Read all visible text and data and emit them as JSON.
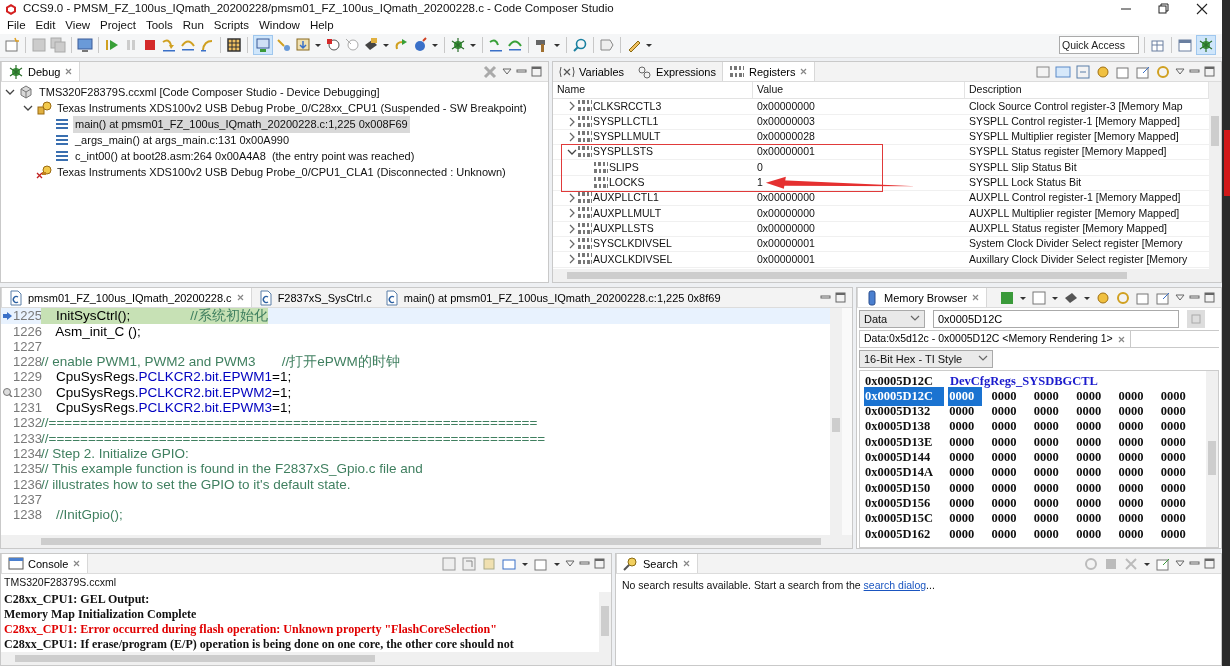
{
  "window": {
    "title": "CCS9.0 - PMSM_FZ_100us_IQmath_20200228/pmsm01_FZ_100us_IQmath_20200228.c - Code Composer Studio"
  },
  "menu": [
    "File",
    "Edit",
    "View",
    "Project",
    "Tools",
    "Run",
    "Scripts",
    "Window",
    "Help"
  ],
  "toolbar": {
    "quick_access": {
      "placeholder": "Quick Access"
    }
  },
  "debug_view": {
    "tab": {
      "label": "Debug",
      "selected": true
    },
    "tree": [
      {
        "label": "TMS320F28379S.ccxml [Code Composer Studio - Device Debugging]",
        "kind": "target",
        "expanded": true,
        "selected": false,
        "children": [
          {
            "label": "Texas Instruments XDS100v2 USB Debug Probe_0/C28xx_CPU1 (Suspended - SW Breakpoint)",
            "kind": "core",
            "expanded": true,
            "selected": false,
            "children": [
              {
                "label": "main() at pmsm01_FZ_100us_IQmath_20200228.c:1,225 0x008F69",
                "kind": "frame",
                "selected": true
              },
              {
                "label": "_args_main() at args_main.c:131 0x00A990",
                "kind": "frame",
                "selected": false
              },
              {
                "label": "c_int00() at boot28.asm:264 0x00A4A8  (the entry point was reached)",
                "kind": "frame",
                "selected": false
              }
            ]
          },
          {
            "label": "Texas Instruments XDS100v2 USB Debug Probe_0/CPU1_CLA1 (Disconnected : Unknown)",
            "kind": "core_disconnected",
            "selected": false
          }
        ]
      }
    ]
  },
  "registers_view": {
    "tabs": [
      {
        "label": "Variables",
        "kind": "variables",
        "selected": false
      },
      {
        "label": "Expressions",
        "kind": "expressions",
        "selected": false
      },
      {
        "label": "Registers",
        "kind": "registers",
        "selected": true
      }
    ],
    "columns": [
      "Name",
      "Value",
      "Description"
    ],
    "rows": [
      {
        "name": "CLKSRCCTL3",
        "value": "0x00000000",
        "description": "Clock Source Control register-3 [Memory Map",
        "expanded": false
      },
      {
        "name": "SYSPLLCTL1",
        "value": "0x00000003",
        "description": "SYSPLL Control register-1 [Memory Mapped]",
        "expanded": false
      },
      {
        "name": "SYSPLLMULT",
        "value": "0x00000028",
        "description": "SYSPLL Multiplier register [Memory Mapped]",
        "expanded": false
      },
      {
        "name": "SYSPLLSTS",
        "value": "0x00000001",
        "description": "SYSPLL Status register [Memory Mapped]",
        "expanded": true,
        "highlighted": true,
        "children": [
          {
            "name": "SLIPS",
            "value": "0",
            "description": "SYSPLL Slip Status Bit"
          },
          {
            "name": "LOCKS",
            "value": "1",
            "description": "SYSPLL Lock Status Bit",
            "arrow": true
          }
        ]
      },
      {
        "name": "AUXPLLCTL1",
        "value": "0x00000000",
        "description": "AUXPLL Control register-1 [Memory Mapped]",
        "expanded": false
      },
      {
        "name": "AUXPLLMULT",
        "value": "0x00000000",
        "description": "AUXPLL Multiplier register [Memory Mapped]",
        "expanded": false
      },
      {
        "name": "AUXPLLSTS",
        "value": "0x00000000",
        "description": "AUXPLL Status register [Memory Mapped]",
        "expanded": false
      },
      {
        "name": "SYSCLKDIVSEL",
        "value": "0x00000001",
        "description": "System Clock Divider Select register [Memory",
        "expanded": false
      },
      {
        "name": "AUXCLKDIVSEL",
        "value": "0x00000001",
        "description": "Auxillary Clock Divider Select register [Memory",
        "expanded": false
      }
    ]
  },
  "editor": {
    "tabs": [
      {
        "label": "pmsm01_FZ_100us_IQmath_20200228.c",
        "selected": true
      },
      {
        "label": "F2837xS_SysCtrl.c",
        "selected": false
      },
      {
        "label": "main() at pmsm01_FZ_100us_IQmath_20200228.c:1,225 0x8f69",
        "selected": false
      }
    ],
    "lines": [
      {
        "number": "1225",
        "current": true,
        "instruction_pointer": true,
        "segments": [
          {
            "kind": "code",
            "text": "    InitSysCtrl();"
          },
          {
            "kind": "comment",
            "text": "                //系统初始化"
          }
        ]
      },
      {
        "number": "1226",
        "segments": [
          {
            "kind": "code",
            "text": "    Asm_init_C ();"
          }
        ]
      },
      {
        "number": "1227"
      },
      {
        "number": "1228",
        "segments": [
          {
            "kind": "comment",
            "text": "// enable PWM1, PWM2 and PWM3       //打开ePWM的时钟"
          }
        ]
      },
      {
        "number": "1229",
        "segments": [
          {
            "kind": "code",
            "text": "    CpuSysRegs."
          },
          {
            "kind": "field",
            "text": "PCLKCR2.bit.EPWM1"
          },
          {
            "kind": "code",
            "text": "=1;"
          }
        ]
      },
      {
        "number": "1230",
        "bookmark": true,
        "segments": [
          {
            "kind": "code",
            "text": "    CpuSysRegs."
          },
          {
            "kind": "field",
            "text": "PCLKCR2.bit.EPWM2"
          },
          {
            "kind": "code",
            "text": "=1;"
          }
        ]
      },
      {
        "number": "1231",
        "segments": [
          {
            "kind": "code",
            "text": "    CpuSysRegs."
          },
          {
            "kind": "field",
            "text": "PCLKCR2.bit.EPWM3"
          },
          {
            "kind": "code",
            "text": "=1;"
          }
        ]
      },
      {
        "number": "1232",
        "segments": [
          {
            "kind": "comment",
            "text": "//=============================================================="
          }
        ]
      },
      {
        "number": "1233",
        "segments": [
          {
            "kind": "comment",
            "text": "//==============================================================="
          }
        ]
      },
      {
        "number": "1234",
        "segments": [
          {
            "kind": "comment",
            "text": "// Step 2. Initialize GPIO:"
          }
        ]
      },
      {
        "number": "1235",
        "segments": [
          {
            "kind": "comment",
            "text": "// This example function is found in the F2837xS_Gpio.c file and"
          }
        ]
      },
      {
        "number": "1236",
        "segments": [
          {
            "kind": "comment",
            "text": "// illustrates how to set the GPIO to it's default state."
          }
        ]
      },
      {
        "number": "1237"
      },
      {
        "number": "1238",
        "segments": [
          {
            "kind": "comment",
            "text": "    //InitGpio();"
          }
        ]
      }
    ]
  },
  "memory_browser": {
    "tab": {
      "label": "Memory Browser",
      "selected": true
    },
    "page": "Data",
    "address": "0x0005D12C",
    "rendering_tab": {
      "label": "Data:0x5d12c - 0x0005D12C <Memory Rendering 1>",
      "selected": true
    },
    "format": "16-Bit Hex - TI Style",
    "symbol": {
      "address": "0x0005D12C",
      "name": "DevCfgRegs_SYSDBGCTL"
    },
    "rows": [
      {
        "address": "0x0005D12C",
        "selected": true,
        "values": [
          {
            "text": "0000",
            "selected": true
          },
          {
            "text": "0000",
            "selected": false
          },
          {
            "text": "0000",
            "selected": false
          },
          {
            "text": "0000",
            "selected": false
          },
          {
            "text": "0000",
            "selected": false
          },
          {
            "text": "0000",
            "selected": false
          }
        ]
      },
      {
        "address": "0x0005D132",
        "selected": false,
        "values": [
          {
            "text": "0000",
            "selected": false
          },
          {
            "text": "0000",
            "selected": false
          },
          {
            "text": "0000",
            "selected": false
          },
          {
            "text": "0000",
            "selected": false
          },
          {
            "text": "0000",
            "selected": false
          },
          {
            "text": "0000",
            "selected": false
          }
        ]
      },
      {
        "address": "0x0005D138",
        "selected": false,
        "values": [
          {
            "text": "0000",
            "selected": false
          },
          {
            "text": "0000",
            "selected": false
          },
          {
            "text": "0000",
            "selected": false
          },
          {
            "text": "0000",
            "selected": false
          },
          {
            "text": "0000",
            "selected": false
          },
          {
            "text": "0000",
            "selected": false
          }
        ]
      },
      {
        "address": "0x0005D13E",
        "selected": false,
        "values": [
          {
            "text": "0000",
            "selected": false
          },
          {
            "text": "0000",
            "selected": false
          },
          {
            "text": "0000",
            "selected": false
          },
          {
            "text": "0000",
            "selected": false
          },
          {
            "text": "0000",
            "selected": false
          },
          {
            "text": "0000",
            "selected": false
          }
        ]
      },
      {
        "address": "0x0005D144",
        "selected": false,
        "values": [
          {
            "text": "0000",
            "selected": false
          },
          {
            "text": "0000",
            "selected": false
          },
          {
            "text": "0000",
            "selected": false
          },
          {
            "text": "0000",
            "selected": false
          },
          {
            "text": "0000",
            "selected": false
          },
          {
            "text": "0000",
            "selected": false
          }
        ]
      },
      {
        "address": "0x0005D14A",
        "selected": false,
        "values": [
          {
            "text": "0000",
            "selected": false
          },
          {
            "text": "0000",
            "selected": false
          },
          {
            "text": "0000",
            "selected": false
          },
          {
            "text": "0000",
            "selected": false
          },
          {
            "text": "0000",
            "selected": false
          },
          {
            "text": "0000",
            "selected": false
          }
        ]
      },
      {
        "address": "0x0005D150",
        "selected": false,
        "values": [
          {
            "text": "0000",
            "selected": false
          },
          {
            "text": "0000",
            "selected": false
          },
          {
            "text": "0000",
            "selected": false
          },
          {
            "text": "0000",
            "selected": false
          },
          {
            "text": "0000",
            "selected": false
          },
          {
            "text": "0000",
            "selected": false
          }
        ]
      },
      {
        "address": "0x0005D156",
        "selected": false,
        "values": [
          {
            "text": "0000",
            "selected": false
          },
          {
            "text": "0000",
            "selected": false
          },
          {
            "text": "0000",
            "selected": false
          },
          {
            "text": "0000",
            "selected": false
          },
          {
            "text": "0000",
            "selected": false
          },
          {
            "text": "0000",
            "selected": false
          }
        ]
      },
      {
        "address": "0x0005D15C",
        "selected": false,
        "values": [
          {
            "text": "0000",
            "selected": false
          },
          {
            "text": "0000",
            "selected": false
          },
          {
            "text": "0000",
            "selected": false
          },
          {
            "text": "0000",
            "selected": false
          },
          {
            "text": "0000",
            "selected": false
          },
          {
            "text": "0000",
            "selected": false
          }
        ]
      },
      {
        "address": "0x0005D162",
        "selected": false,
        "values": [
          {
            "text": "0000",
            "selected": false
          },
          {
            "text": "0000",
            "selected": false
          },
          {
            "text": "0000",
            "selected": false
          },
          {
            "text": "0000",
            "selected": false
          },
          {
            "text": "0000",
            "selected": false
          },
          {
            "text": "0000",
            "selected": false
          }
        ]
      }
    ]
  },
  "console": {
    "tab": {
      "label": "Console",
      "selected": true
    },
    "session": "TMS320F28379S.ccxml",
    "lines": [
      {
        "kind": "output",
        "text": "C28xx_CPU1: GEL Output:"
      },
      {
        "kind": "output",
        "text": "Memory Map Initialization Complete"
      },
      {
        "kind": "error",
        "text": "C28xx_CPU1: Error occurred during flash operation: Unknown property \"FlashCoreSelection\""
      },
      {
        "kind": "output",
        "text": "C28xx_CPU1: If erase/program (E/P) operation is being done on one core, the other core should not"
      }
    ]
  },
  "search_view": {
    "tab": {
      "label": "Search",
      "selected": true
    },
    "message": {
      "before": "No search results available. Start a search from the ",
      "link": "search dialog",
      "after": "..."
    }
  }
}
